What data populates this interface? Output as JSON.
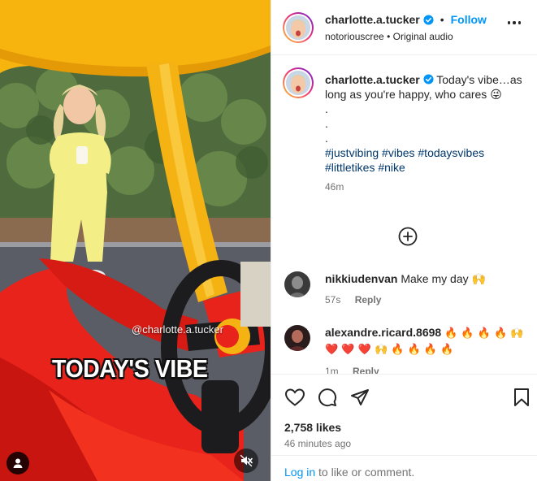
{
  "media": {
    "overlay_handle": "@charlotte.a.tucker",
    "overlay_caption": "TODAY'S VIBE",
    "tag_icon": "user-tag-icon",
    "mute_icon": "speaker-muted-icon"
  },
  "header": {
    "username": "charlotte.a.tucker",
    "separator": "•",
    "follow_label": "Follow",
    "audio_source": "notoriouscree",
    "audio_sep": "•",
    "audio_label": "Original audio"
  },
  "caption": {
    "username": "charlotte.a.tucker",
    "text": "Today's vibe…as long as you're happy, who cares 😜",
    "dots": [
      ".",
      ".",
      "."
    ],
    "hashtags": "#justvibing #vibes #todaysvibes #littletikes #nike",
    "time": "46m"
  },
  "comments": [
    {
      "username": "nikkiudenvan",
      "text": "Make my day 🙌",
      "time": "57s",
      "reply": "Reply"
    },
    {
      "username": "alexandre.ricard.8698",
      "text": "🔥 🔥 🔥 🔥 🙌 ❤️ ❤️ ❤️ 🙌 🔥 🔥 🔥 🔥",
      "time": "1m",
      "reply": "Reply"
    }
  ],
  "actions": {
    "likes": "2,758 likes",
    "time_ago": "46 minutes ago"
  },
  "login": {
    "link": "Log in",
    "text": " to like or comment."
  },
  "colors": {
    "accent": "#0095f6",
    "hashtag": "#00376b",
    "muted": "#737373",
    "verified": "#0095f6",
    "fire": "#f26b1d",
    "heart": "#ed4956"
  }
}
